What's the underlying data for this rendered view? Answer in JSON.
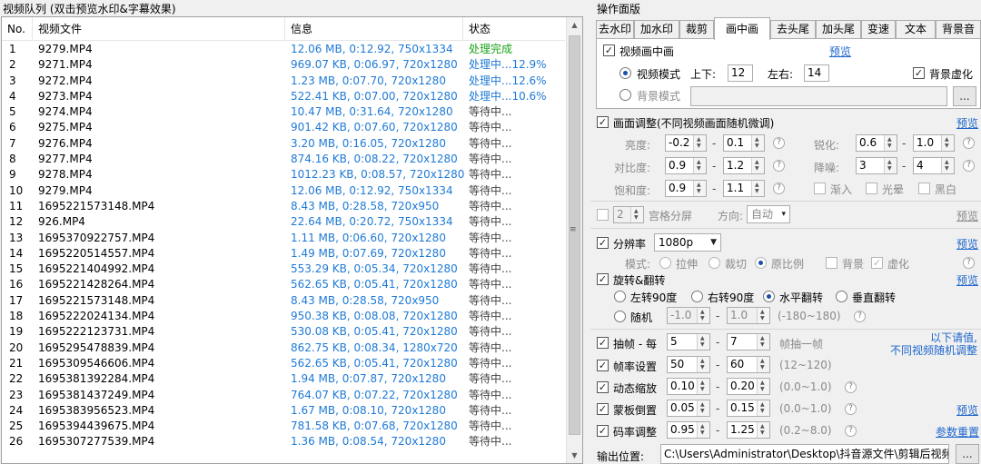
{
  "queue": {
    "title": "视频队列 (双击预览水印&字幕效果)",
    "columns": [
      "No.",
      "视频文件",
      "信息",
      "状态"
    ],
    "rows": [
      {
        "no": "1",
        "file": "9279.MP4",
        "info": "12.06 MB, 0:12.92, 750x1334",
        "status": "处理完成",
        "state": "done"
      },
      {
        "no": "2",
        "file": "9271.MP4",
        "info": "969.07 KB, 0:06.97, 720x1280",
        "status": "处理中...12.9%",
        "state": "proc"
      },
      {
        "no": "3",
        "file": "9272.MP4",
        "info": "1.23 MB, 0:07.70, 720x1280",
        "status": "处理中...12.6%",
        "state": "proc"
      },
      {
        "no": "4",
        "file": "9273.MP4",
        "info": "522.41 KB, 0:07.00, 720x1280",
        "status": "处理中...10.6%",
        "state": "proc"
      },
      {
        "no": "5",
        "file": "9274.MP4",
        "info": "10.47 MB, 0:31.64, 720x1280",
        "status": "等待中...",
        "state": "wait"
      },
      {
        "no": "6",
        "file": "9275.MP4",
        "info": "901.42 KB, 0:07.60, 720x1280",
        "status": "等待中...",
        "state": "wait"
      },
      {
        "no": "7",
        "file": "9276.MP4",
        "info": "3.20 MB, 0:16.05, 720x1280",
        "status": "等待中...",
        "state": "wait"
      },
      {
        "no": "8",
        "file": "9277.MP4",
        "info": "874.16 KB, 0:08.22, 720x1280",
        "status": "等待中...",
        "state": "wait"
      },
      {
        "no": "9",
        "file": "9278.MP4",
        "info": "1012.23 KB, 0:08.57, 720x1280",
        "status": "等待中...",
        "state": "wait"
      },
      {
        "no": "10",
        "file": "9279.MP4",
        "info": "12.06 MB, 0:12.92, 750x1334",
        "status": "等待中...",
        "state": "wait"
      },
      {
        "no": "11",
        "file": "1695221573148.MP4",
        "info": "8.43 MB, 0:28.58, 720x950",
        "status": "等待中...",
        "state": "wait"
      },
      {
        "no": "12",
        "file": "926.MP4",
        "info": "22.64 MB, 0:20.72, 750x1334",
        "status": "等待中...",
        "state": "wait"
      },
      {
        "no": "13",
        "file": "1695370922757.MP4",
        "info": "1.11 MB, 0:06.60, 720x1280",
        "status": "等待中...",
        "state": "wait"
      },
      {
        "no": "14",
        "file": "1695220514557.MP4",
        "info": "1.49 MB, 0:07.69, 720x1280",
        "status": "等待中...",
        "state": "wait"
      },
      {
        "no": "15",
        "file": "1695221404992.MP4",
        "info": "553.29 KB, 0:05.34, 720x1280",
        "status": "等待中...",
        "state": "wait"
      },
      {
        "no": "16",
        "file": "1695221428264.MP4",
        "info": "562.65 KB, 0:05.41, 720x1280",
        "status": "等待中...",
        "state": "wait"
      },
      {
        "no": "17",
        "file": "1695221573148.MP4",
        "info": "8.43 MB, 0:28.58, 720x950",
        "status": "等待中...",
        "state": "wait"
      },
      {
        "no": "18",
        "file": "1695222024134.MP4",
        "info": "950.38 KB, 0:08.08, 720x1280",
        "status": "等待中...",
        "state": "wait"
      },
      {
        "no": "19",
        "file": "1695222123731.MP4",
        "info": "530.08 KB, 0:05.41, 720x1280",
        "status": "等待中...",
        "state": "wait"
      },
      {
        "no": "20",
        "file": "1695295478839.MP4",
        "info": "862.75 KB, 0:08.34, 1280x720",
        "status": "等待中...",
        "state": "wait"
      },
      {
        "no": "21",
        "file": "1695309546606.MP4",
        "info": "562.65 KB, 0:05.41, 720x1280",
        "status": "等待中...",
        "state": "wait"
      },
      {
        "no": "22",
        "file": "1695381392284.MP4",
        "info": "1.94 MB, 0:07.87, 720x1280",
        "status": "等待中...",
        "state": "wait"
      },
      {
        "no": "23",
        "file": "1695381437249.MP4",
        "info": "764.07 KB, 0:07.22, 720x1280",
        "status": "等待中...",
        "state": "wait"
      },
      {
        "no": "24",
        "file": "1695383956523.MP4",
        "info": "1.67 MB, 0:08.10, 720x1280",
        "status": "等待中...",
        "state": "wait"
      },
      {
        "no": "25",
        "file": "1695394439675.MP4",
        "info": "781.58 KB, 0:07.68, 720x1280",
        "status": "等待中...",
        "state": "wait"
      },
      {
        "no": "26",
        "file": "1695307277539.MP4",
        "info": "1.36 MB, 0:08.54, 720x1280",
        "status": "等待中...",
        "state": "wait"
      }
    ]
  },
  "panel": {
    "title": "操作面版",
    "tabs": [
      "去水印",
      "加水印",
      "裁剪",
      "画中画",
      "去头尾",
      "加头尾",
      "变速",
      "文本",
      "背景音"
    ],
    "active_tab": "画中画"
  },
  "pip": {
    "enable_label": "视频画中画",
    "preview": "预览",
    "video_mode": "视频模式",
    "updown_label": "上下:",
    "updown_value": "12",
    "leftright_label": "左右:",
    "leftright_value": "14",
    "bg_blur_label": "背景虚化",
    "bg_mode": "背景模式",
    "browse": "..."
  },
  "adjust": {
    "label": "画面调整(不同视频画面随机微调)",
    "preview": "预览",
    "brightness_label": "亮度:",
    "brightness_min": "-0.2",
    "brightness_max": "0.1",
    "sharpen_label": "锐化:",
    "sharpen_min": "0.6",
    "sharpen_max": "1.0",
    "contrast_label": "对比度:",
    "contrast_min": "0.9",
    "contrast_max": "1.2",
    "denoise_label": "降噪:",
    "denoise_min": "3",
    "denoise_max": "4",
    "saturation_label": "饱和度:",
    "saturation_min": "0.9",
    "saturation_max": "1.1",
    "fadein": "渐入",
    "halo": "光晕",
    "bw": "黑白"
  },
  "grid": {
    "count": "2",
    "label": "宫格分屏",
    "direction_label": "方向:",
    "direction_value": "自动",
    "preview": "预览"
  },
  "resolution": {
    "label": "分辨率",
    "value": "1080p",
    "preview": "预览",
    "mode_label": "模式:",
    "stretch": "拉伸",
    "crop": "裁切",
    "original": "原比例",
    "background": "背景",
    "blur": "虚化"
  },
  "rotate": {
    "label": "旋转&翻转",
    "preview": "预览",
    "left90": "左转90度",
    "right90": "右转90度",
    "hflip": "水平翻转",
    "vflip": "垂直翻转",
    "random": "随机",
    "rand_min": "-1.0",
    "rand_max": "1.0",
    "range": "(-180~180)"
  },
  "framedrop": {
    "label": "抽帧 - 每",
    "min": "5",
    "max": "7",
    "suffix": "帧抽一帧",
    "note_line1": "以下请值,",
    "note_line2": "不同视频随机调整"
  },
  "fps": {
    "label": "帧率设置",
    "min": "50",
    "max": "60",
    "range": "(12~120)"
  },
  "zoom": {
    "label": "动态缩放",
    "min": "0.10",
    "max": "0.20",
    "range": "(0.0~1.0)"
  },
  "mask": {
    "label": "蒙板倒置",
    "min": "0.05",
    "max": "0.15",
    "range": "(0.0~1.0)",
    "preview": "预览"
  },
  "bitrate": {
    "label": "码率调整",
    "min": "0.95",
    "max": "1.25",
    "range": "(0.2~8.0)",
    "reset": "参数重置"
  },
  "output": {
    "label": "输出位置:",
    "path": "C:\\Users\\Administrator\\Desktop\\抖音源文件\\剪辑后视频",
    "browse": "..."
  }
}
